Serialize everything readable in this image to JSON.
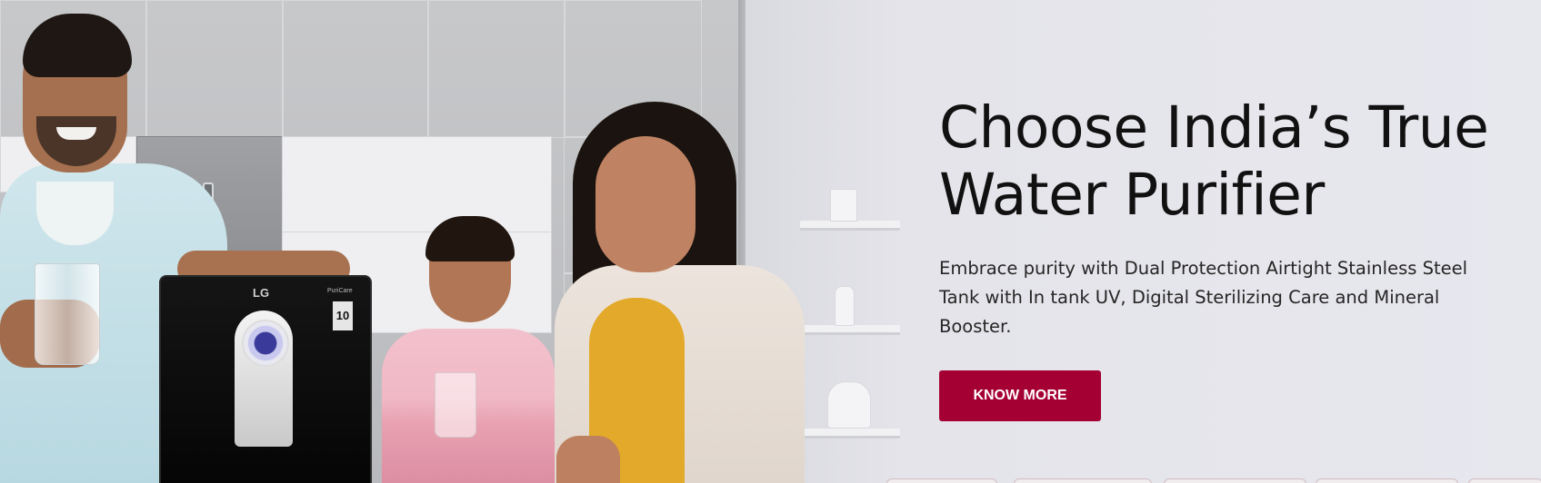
{
  "hero": {
    "headline_line1": "Choose India’s True",
    "headline_line2": "Water Purifier",
    "description": "Embrace purity with Dual Protection Airtight Stainless Steel Tank with In tank UV, Digital Sterilizing Care and Mineral Booster.",
    "cta_label": "KNOW MORE",
    "accent_color": "#a50034"
  },
  "product": {
    "brand_logo": "LG",
    "series_label": "PuriCare",
    "badge_value": "10"
  }
}
